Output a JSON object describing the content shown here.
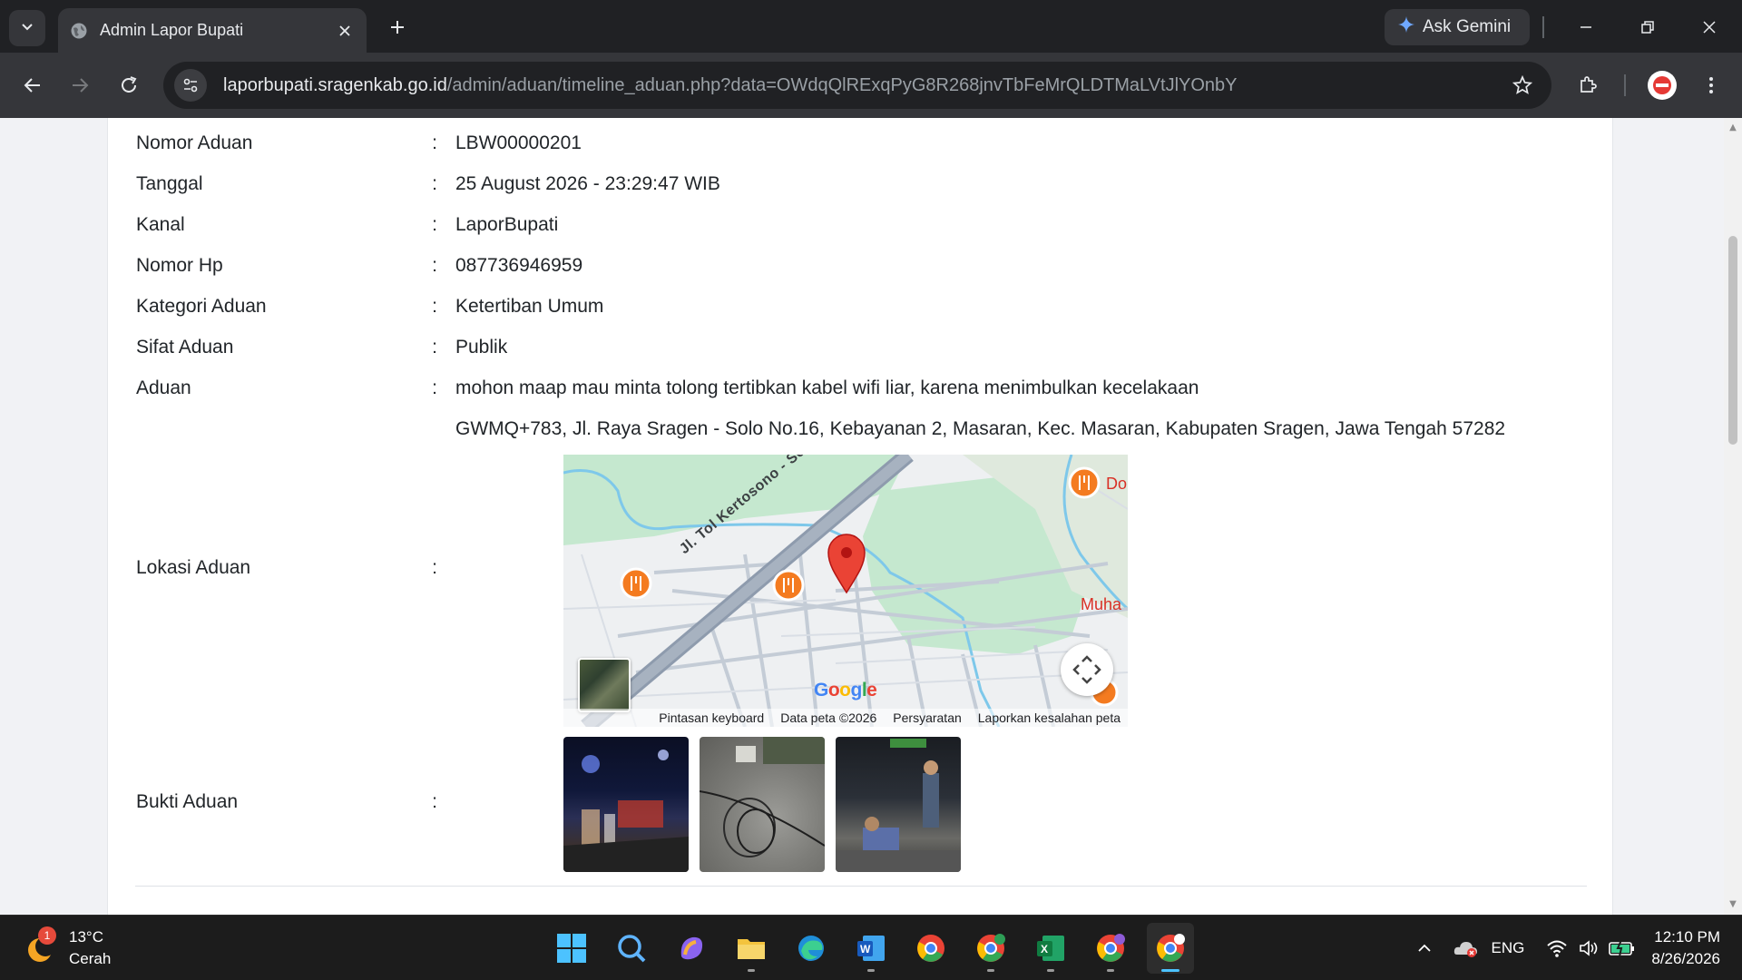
{
  "browser": {
    "tab_title": "Admin Lapor Bupati",
    "ask_gemini": "Ask Gemini",
    "url_host": "laporbupati.sragenkab.go.id",
    "url_path": "/admin/aduan/timeline_aduan.php?data=OWdqQlRExqPyG8R268jnvTbFeMrQLDTMaLVtJlYOnbY"
  },
  "detail": {
    "rows": [
      {
        "label": "Nomor Aduan",
        "colon": ":",
        "value": "LBW00000201"
      },
      {
        "label": "Tanggal",
        "colon": ":",
        "value": "25 August 2026 - 23:29:47 WIB"
      },
      {
        "label": "Kanal",
        "colon": ":",
        "value": "LaporBupati"
      },
      {
        "label": "Nomor Hp",
        "colon": ":",
        "value": "087736946959"
      },
      {
        "label": "Kategori Aduan",
        "colon": ":",
        "value": "Ketertiban Umum"
      },
      {
        "label": "Sifat Aduan",
        "colon": ":",
        "value": "Publik"
      },
      {
        "label": "Aduan",
        "colon": ":",
        "value": "mohon maap mau minta tolong tertibkan kabel wifi liar, karena menimbulkan kecelakaan"
      }
    ],
    "lokasi": {
      "label": "Lokasi Aduan",
      "colon": ":",
      "address": "GWMQ+783, Jl. Raya Sragen - Solo No.16, Kebayanan 2, Masaran, Kec. Masaran, Kabupaten Sragen, Jawa Tengah 57282"
    },
    "bukti": {
      "label": "Bukti Aduan",
      "colon": ":"
    }
  },
  "map": {
    "road_label": "Jl. Tol Kertosono - Solo",
    "poi_do": "Do",
    "poi_muha": "Muha",
    "footer": {
      "shortcuts": "Pintasan keyboard",
      "map_data": "Data peta ©2026",
      "terms": "Persyaratan",
      "report": "Laporkan kesalahan peta"
    }
  },
  "taskbar": {
    "weather_temp": "13°C",
    "weather_desc": "Cerah",
    "weather_badge": "1",
    "lang": "ENG",
    "time": "12:10 PM",
    "date": "8/26/2026"
  },
  "colors": {
    "chrome_dark": "#202124",
    "chrome_toolbar": "#35363a",
    "map_green": "#c5e8cf",
    "map_water": "#7ec8ea",
    "pin_red": "#ea4335",
    "poi_orange": "#f47b20"
  }
}
